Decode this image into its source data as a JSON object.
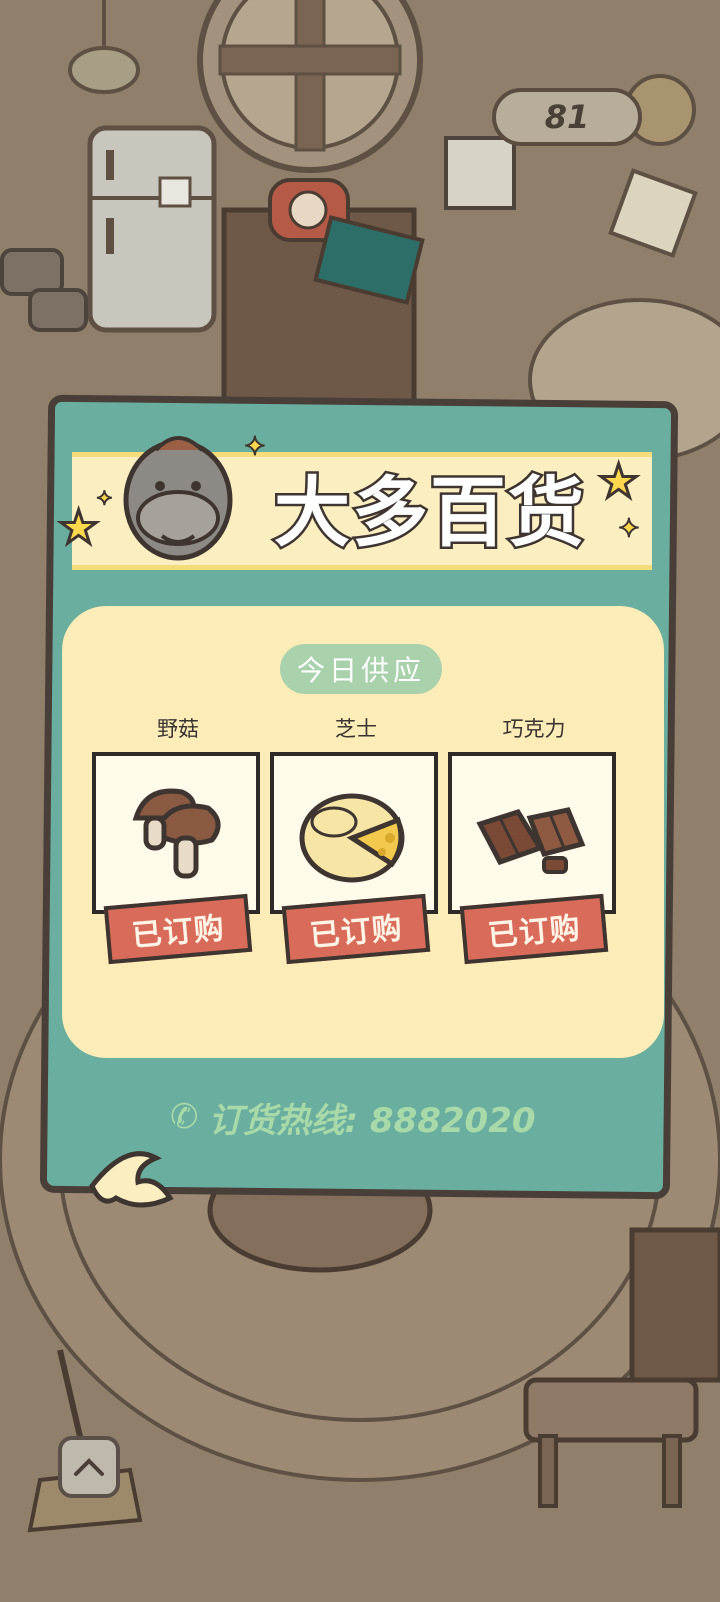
{
  "hud": {
    "clover_count": "81"
  },
  "shop": {
    "title": "大多百货",
    "section_label": "今日供应",
    "items": [
      {
        "name": "野菇",
        "status": "已订购",
        "icon": "mushroom-icon"
      },
      {
        "name": "芝士",
        "status": "已订购",
        "icon": "cheese-icon"
      },
      {
        "name": "巧克力",
        "status": "已订购",
        "icon": "chocolate-icon"
      }
    ],
    "hotline": "订货热线: 8882020"
  },
  "colors": {
    "panel": "#6aaea0",
    "board": "#fcedb8",
    "tag": "#d86b5a",
    "outline": "#3e3530"
  }
}
